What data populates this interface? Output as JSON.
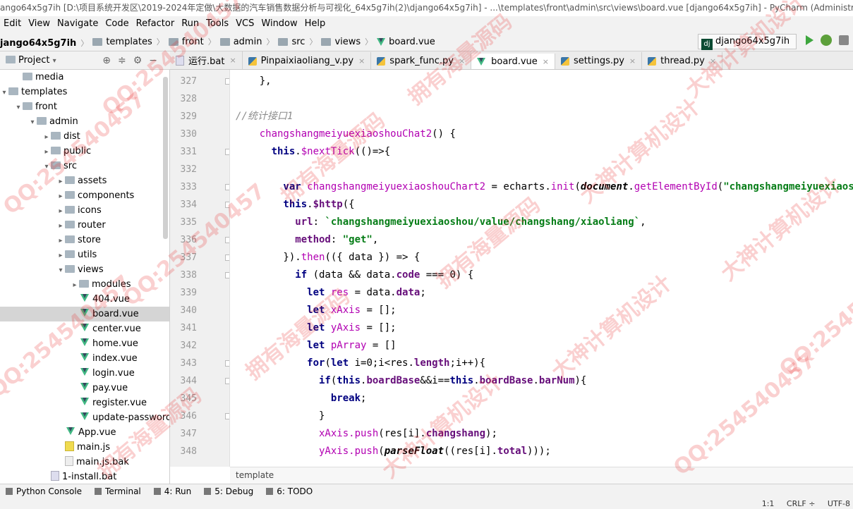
{
  "window": {
    "title": "ango64x5g7ih [D:\\项目系统开发区\\2019-2024年定做\\大数据的汽车销售数据分析与可视化_64x5g7ih(2)\\django64x5g7ih] - ...\\templates\\front\\admin\\src\\views\\board.vue [django64x5g7ih] - PyCharm (Administr..."
  },
  "menu": [
    "Edit",
    "View",
    "Navigate",
    "Code",
    "Refactor",
    "Run",
    "Tools",
    "VCS",
    "Window",
    "Help"
  ],
  "navbar": {
    "project": "jango64x5g7ih",
    "crumbs": [
      "templates",
      "front",
      "admin",
      "src",
      "views"
    ],
    "file": "board.vue",
    "run_config": "django64x5g7ih"
  },
  "project_panel": {
    "title": "Project"
  },
  "tree": [
    {
      "label": "media",
      "indent": 1,
      "arrow": "",
      "type": "folder"
    },
    {
      "label": "templates",
      "indent": 0,
      "arrow": "▾",
      "type": "folder"
    },
    {
      "label": "front",
      "indent": 1,
      "arrow": "▾",
      "type": "folder"
    },
    {
      "label": "admin",
      "indent": 2,
      "arrow": "▾",
      "type": "folder"
    },
    {
      "label": "dist",
      "indent": 3,
      "arrow": "▸",
      "type": "folder"
    },
    {
      "label": "public",
      "indent": 3,
      "arrow": "▸",
      "type": "folder"
    },
    {
      "label": "src",
      "indent": 3,
      "arrow": "▾",
      "type": "folder"
    },
    {
      "label": "assets",
      "indent": 4,
      "arrow": "▸",
      "type": "folder"
    },
    {
      "label": "components",
      "indent": 4,
      "arrow": "▸",
      "type": "folder"
    },
    {
      "label": "icons",
      "indent": 4,
      "arrow": "▸",
      "type": "folder"
    },
    {
      "label": "router",
      "indent": 4,
      "arrow": "▸",
      "type": "folder"
    },
    {
      "label": "store",
      "indent": 4,
      "arrow": "▸",
      "type": "folder"
    },
    {
      "label": "utils",
      "indent": 4,
      "arrow": "▸",
      "type": "folder"
    },
    {
      "label": "views",
      "indent": 4,
      "arrow": "▾",
      "type": "folder"
    },
    {
      "label": "modules",
      "indent": 5,
      "arrow": "▸",
      "type": "folder"
    },
    {
      "label": "404.vue",
      "indent": 5,
      "arrow": "",
      "type": "vue"
    },
    {
      "label": "board.vue",
      "indent": 5,
      "arrow": "",
      "type": "vue",
      "selected": true
    },
    {
      "label": "center.vue",
      "indent": 5,
      "arrow": "",
      "type": "vue"
    },
    {
      "label": "home.vue",
      "indent": 5,
      "arrow": "",
      "type": "vue"
    },
    {
      "label": "index.vue",
      "indent": 5,
      "arrow": "",
      "type": "vue"
    },
    {
      "label": "login.vue",
      "indent": 5,
      "arrow": "",
      "type": "vue"
    },
    {
      "label": "pay.vue",
      "indent": 5,
      "arrow": "",
      "type": "vue"
    },
    {
      "label": "register.vue",
      "indent": 5,
      "arrow": "",
      "type": "vue"
    },
    {
      "label": "update-passworc",
      "indent": 5,
      "arrow": "",
      "type": "vue"
    },
    {
      "label": "App.vue",
      "indent": 4,
      "arrow": "",
      "type": "vue"
    },
    {
      "label": "main.js",
      "indent": 4,
      "arrow": "",
      "type": "js"
    },
    {
      "label": "main.js.bak",
      "indent": 4,
      "arrow": "",
      "type": "bak"
    },
    {
      "label": "1-install.bat",
      "indent": 3,
      "arrow": "",
      "type": "bat"
    }
  ],
  "tabs": [
    {
      "label": "运行.bat",
      "icon": "bat",
      "active": false
    },
    {
      "label": "Pinpaixiaoliang_v.py",
      "icon": "py",
      "active": false
    },
    {
      "label": "spark_func.py",
      "icon": "py",
      "active": false
    },
    {
      "label": "board.vue",
      "icon": "vue",
      "active": true
    },
    {
      "label": "settings.py",
      "icon": "py",
      "active": false
    },
    {
      "label": "thread.py",
      "icon": "py",
      "active": false
    }
  ],
  "line_numbers": [
    "327",
    "328",
    "329",
    "330",
    "331",
    "332",
    "333",
    "334",
    "335",
    "336",
    "337",
    "338",
    "339",
    "340",
    "341",
    "342",
    "343",
    "344",
    "345",
    "346",
    "347",
    "348"
  ],
  "code": [
    [
      {
        "t": "    },",
        "c": "var"
      }
    ],
    [],
    [
      {
        "t": "//统计接口1",
        "c": "cmt"
      }
    ],
    [
      {
        "t": "    changshangmeiyuexiaoshouChat2",
        "c": "fn"
      },
      {
        "t": "() {",
        "c": "var"
      }
    ],
    [
      {
        "t": "      this",
        "c": "kw"
      },
      {
        "t": ".",
        "c": "var"
      },
      {
        "t": "$nextTick",
        "c": "fn"
      },
      {
        "t": "(()=>{",
        "c": "var"
      }
    ],
    [],
    [
      {
        "t": "        var ",
        "c": "kw"
      },
      {
        "t": "changshangmeiyuexiaoshouChart2",
        "c": "fn"
      },
      {
        "t": " = echarts.",
        "c": "var"
      },
      {
        "t": "init",
        "c": "fn"
      },
      {
        "t": "(",
        "c": "var"
      },
      {
        "t": "document",
        "c": "it"
      },
      {
        "t": ".",
        "c": "var"
      },
      {
        "t": "getElementById",
        "c": "fn"
      },
      {
        "t": "(",
        "c": "var"
      },
      {
        "t": "\"changshangmeiyuexiaoshouCha",
        "c": "str"
      }
    ],
    [
      {
        "t": "        this",
        "c": "kw"
      },
      {
        "t": ".",
        "c": "var"
      },
      {
        "t": "$http",
        "c": "field"
      },
      {
        "t": "({",
        "c": "var"
      }
    ],
    [
      {
        "t": "          url",
        "c": "field"
      },
      {
        "t": ": ",
        "c": "var"
      },
      {
        "t": "`changshangmeiyuexiaoshou/value/changshang/xiaoliang`",
        "c": "str"
      },
      {
        "t": ",",
        "c": "var"
      }
    ],
    [
      {
        "t": "          method",
        "c": "field"
      },
      {
        "t": ": ",
        "c": "var"
      },
      {
        "t": "\"get\"",
        "c": "str"
      },
      {
        "t": ",",
        "c": "var"
      }
    ],
    [
      {
        "t": "        }).",
        "c": "var"
      },
      {
        "t": "then",
        "c": "fn"
      },
      {
        "t": "(({ data }) => {",
        "c": "var"
      }
    ],
    [
      {
        "t": "          if ",
        "c": "kw"
      },
      {
        "t": "(data && data.",
        "c": "var"
      },
      {
        "t": "code",
        "c": "field"
      },
      {
        "t": " === 0) {",
        "c": "var"
      }
    ],
    [
      {
        "t": "            let ",
        "c": "kw"
      },
      {
        "t": "res",
        "c": "fn"
      },
      {
        "t": " = data.",
        "c": "var"
      },
      {
        "t": "data",
        "c": "field"
      },
      {
        "t": ";",
        "c": "var"
      }
    ],
    [
      {
        "t": "            let ",
        "c": "kw"
      },
      {
        "t": "xAxis",
        "c": "fn"
      },
      {
        "t": " = [];",
        "c": "var"
      }
    ],
    [
      {
        "t": "            let ",
        "c": "kw"
      },
      {
        "t": "yAxis",
        "c": "fn"
      },
      {
        "t": " = [];",
        "c": "var"
      }
    ],
    [
      {
        "t": "            let ",
        "c": "kw"
      },
      {
        "t": "pArray",
        "c": "fn"
      },
      {
        "t": " = []",
        "c": "var"
      }
    ],
    [
      {
        "t": "            for",
        "c": "kw"
      },
      {
        "t": "(",
        "c": "var"
      },
      {
        "t": "let ",
        "c": "kw"
      },
      {
        "t": "i=0;i<res.",
        "c": "var"
      },
      {
        "t": "length",
        "c": "field"
      },
      {
        "t": ";i++){",
        "c": "var"
      }
    ],
    [
      {
        "t": "              if",
        "c": "kw"
      },
      {
        "t": "(",
        "c": "var"
      },
      {
        "t": "this",
        "c": "kw"
      },
      {
        "t": ".",
        "c": "var"
      },
      {
        "t": "boardBase",
        "c": "field"
      },
      {
        "t": "&&i==",
        "c": "var"
      },
      {
        "t": "this",
        "c": "kw"
      },
      {
        "t": ".",
        "c": "var"
      },
      {
        "t": "boardBase",
        "c": "field"
      },
      {
        "t": ".",
        "c": "var"
      },
      {
        "t": "barNum",
        "c": "field"
      },
      {
        "t": "){",
        "c": "var"
      }
    ],
    [
      {
        "t": "                break",
        "c": "kw"
      },
      {
        "t": ";",
        "c": "var"
      }
    ],
    [
      {
        "t": "              }",
        "c": "var"
      }
    ],
    [
      {
        "t": "              xAxis.",
        "c": "fn"
      },
      {
        "t": "push",
        "c": "fn"
      },
      {
        "t": "(res[i].",
        "c": "var"
      },
      {
        "t": "changshang",
        "c": "field"
      },
      {
        "t": ");",
        "c": "var"
      }
    ],
    [
      {
        "t": "              yAxis.",
        "c": "fn"
      },
      {
        "t": "push",
        "c": "fn"
      },
      {
        "t": "(",
        "c": "var"
      },
      {
        "t": "parseFloat",
        "c": "it"
      },
      {
        "t": "((res[i].",
        "c": "var"
      },
      {
        "t": "total",
        "c": "field"
      },
      {
        "t": ")));",
        "c": "var"
      }
    ]
  ],
  "bottom_breadcrumb": "template",
  "bottom_tools": [
    "Python Console",
    "Terminal",
    "4: Run",
    "5: Debug",
    "6: TODO"
  ],
  "status": {
    "position": "1:1",
    "line_sep": "CRLF ÷",
    "encoding": "UTF-8"
  },
  "watermarks": [
    "QQ:254540457",
    "拥有海量源码",
    "大神计算机设计"
  ]
}
